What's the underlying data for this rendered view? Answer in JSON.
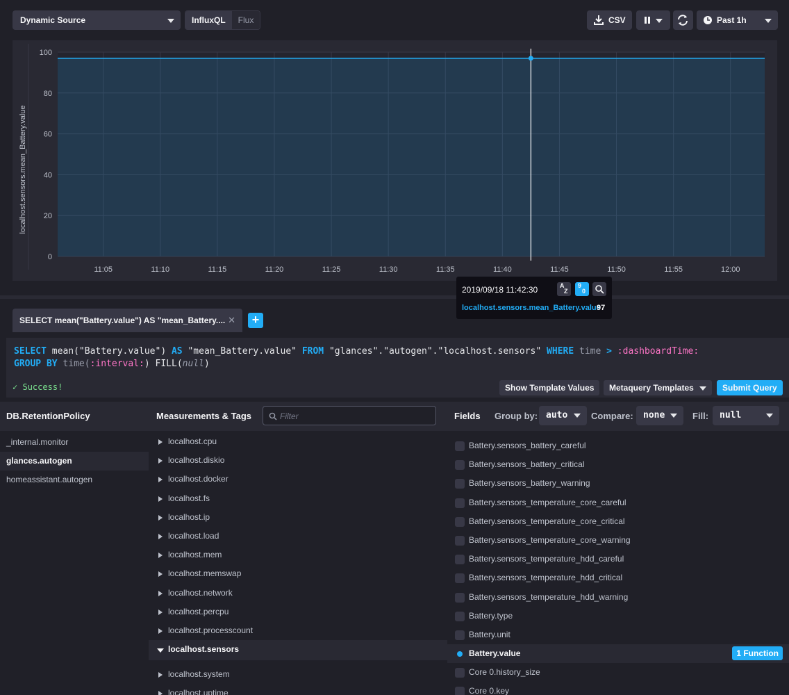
{
  "toolbar": {
    "source_label": "Dynamic Source",
    "lang_influxql": "InfluxQL",
    "lang_flux": "Flux",
    "csv_label": "CSV",
    "timerange_label": "Past 1h"
  },
  "chart_data": {
    "type": "area",
    "ylabel": "localhost.sensors.mean_Battery.value",
    "ylim": [
      0,
      100
    ],
    "yticks": [
      0,
      20,
      40,
      60,
      80,
      100
    ],
    "xticks": [
      "11:05",
      "11:10",
      "11:15",
      "11:20",
      "11:25",
      "11:30",
      "11:35",
      "11:40",
      "11:45",
      "11:50",
      "11:55",
      "12:00"
    ],
    "series": [
      {
        "name": "localhost.sensors.mean_Battery.value",
        "x": [
          "11:01",
          "12:03"
        ],
        "values": [
          97,
          97
        ],
        "color": "#22adf6"
      }
    ],
    "hover_x": "11:42:30",
    "grid": true
  },
  "tooltip": {
    "time": "2019/09/18 11:42:30",
    "series": "localhost.sensors.mean_Battery.value",
    "value": "97",
    "sort_az_a": "A",
    "sort_az_z": "Z",
    "sort_90_9": "9",
    "sort_90_0": "0"
  },
  "query": {
    "tab_label": "SELECT mean(\"Battery.value\") AS \"mean_Battery....",
    "add_label": "+",
    "status": "Success!",
    "show_template_values": "Show Template Values",
    "metaquery_templates": "Metaquery Templates",
    "submit": "Submit Query",
    "code": {
      "select": "SELECT",
      "fn": " mean(\"Battery.value\") ",
      "as": "AS",
      "alias": " \"mean_Battery.value\" ",
      "from": "FROM",
      "source": " \"glances\".\"autogen\".\"localhost.sensors\" ",
      "where": "WHERE",
      "time": " time ",
      "gt": ">",
      "dash_time": " :dashboardTime:",
      "group_by": "GROUP BY",
      "time_fn": " time(",
      "interval": ":interval:",
      "close_fill": ") FILL(",
      "null": "null",
      "close": ")"
    }
  },
  "explorer": {
    "db_title": "DB.RetentionPolicy",
    "meas_title": "Measurements & Tags",
    "filter_placeholder": "Filter",
    "fields_title": "Fields",
    "group_by_label": "Group by:",
    "group_by_value": "auto",
    "compare_label": "Compare:",
    "compare_value": "none",
    "fill_label": "Fill:",
    "fill_value": "null",
    "databases": [
      "_internal.monitor",
      "glances.autogen",
      "homeassistant.autogen"
    ],
    "measurements": [
      "localhost.cpu",
      "localhost.diskio",
      "localhost.docker",
      "localhost.fs",
      "localhost.ip",
      "localhost.load",
      "localhost.mem",
      "localhost.memswap",
      "localhost.network",
      "localhost.percpu",
      "localhost.processcount",
      "localhost.sensors",
      "localhost.system",
      "localhost.uptime"
    ],
    "fields": [
      "Battery.sensors_battery_careful",
      "Battery.sensors_battery_critical",
      "Battery.sensors_battery_warning",
      "Battery.sensors_temperature_core_careful",
      "Battery.sensors_temperature_core_critical",
      "Battery.sensors_temperature_core_warning",
      "Battery.sensors_temperature_hdd_careful",
      "Battery.sensors_temperature_hdd_critical",
      "Battery.sensors_temperature_hdd_warning",
      "Battery.type",
      "Battery.unit",
      "Battery.value",
      "Core 0.history_size",
      "Core 0.key"
    ],
    "function_badge": "1 Function"
  },
  "colors": {
    "accent": "#22adf6",
    "background": "#202028",
    "panel": "#292933",
    "success": "#7ce490",
    "template_var": "#ff76c8"
  }
}
